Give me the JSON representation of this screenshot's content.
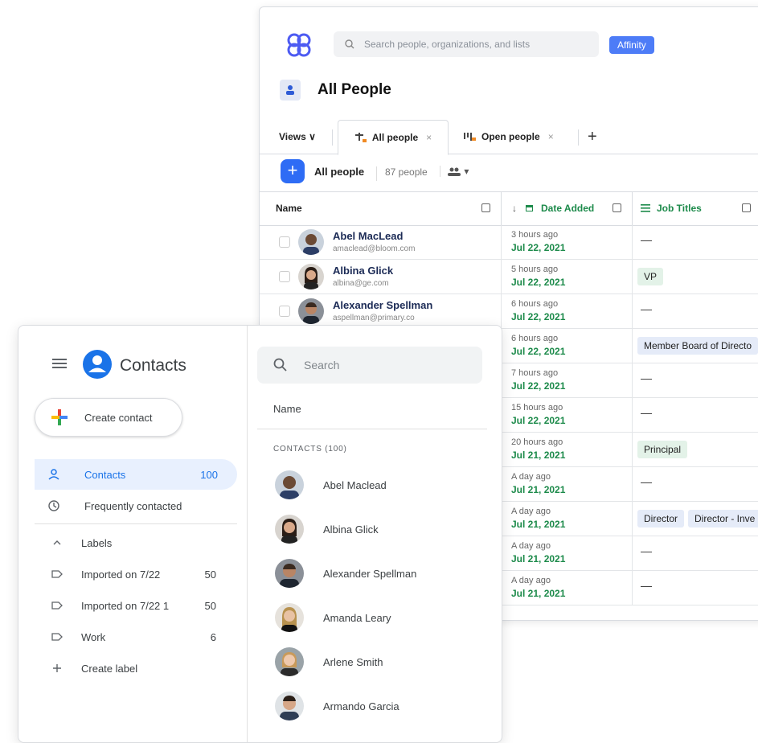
{
  "affinity": {
    "search_placeholder": "Search people, organizations, and lists",
    "badge": "Affinity",
    "title": "All People",
    "views_label": "Views ∨",
    "tabs": [
      {
        "label": "All people",
        "close": "×"
      },
      {
        "label": "Open people",
        "close": "×"
      }
    ],
    "add_tab": "+",
    "list_title": "All people",
    "people_count": "87 people",
    "people_dropdown": "▾",
    "columns": {
      "name": "Name",
      "date_added": "Date Added",
      "job_titles": "Job Titles",
      "date_sort": "↓"
    },
    "rows": [
      {
        "name": "Abel MacLead",
        "email": "amaclead@bloom.com",
        "rel": "3 hours ago",
        "date": "Jul 22, 2021",
        "job": "—"
      },
      {
        "name": "Albina Glick",
        "email": "albina@ge.com",
        "rel": "5 hours ago",
        "date": "Jul 22, 2021",
        "job": "VP"
      },
      {
        "name": "Alexander Spellman",
        "email": "aspellman@primary.co",
        "rel": "6 hours ago",
        "date": "Jul 22, 2021",
        "job": "—"
      },
      {
        "name": "",
        "email": "",
        "rel": "6 hours ago",
        "date": "Jul 22, 2021",
        "job": "Member Board of Directo"
      },
      {
        "name": "",
        "email": "",
        "rel": "7 hours ago",
        "date": "Jul 22, 2021",
        "job": "—"
      },
      {
        "name": "",
        "email": "",
        "rel": "15 hours ago",
        "date": "Jul 22, 2021",
        "job": "—"
      },
      {
        "name": "",
        "email": "",
        "rel": "20 hours ago",
        "date": "Jul 21, 2021",
        "job": "Principal"
      },
      {
        "name": "",
        "email": "",
        "rel": "A day ago",
        "date": "Jul 21, 2021",
        "job": "—"
      },
      {
        "name": "",
        "email": "",
        "rel": "A day ago",
        "date": "Jul 21, 2021",
        "job": "Director",
        "job2": "Director - Inve"
      },
      {
        "name": "",
        "email": "",
        "rel": "A day ago",
        "date": "Jul 21, 2021",
        "job": "—"
      },
      {
        "name": "",
        "email": "",
        "rel": "A day ago",
        "date": "Jul 21, 2021",
        "job": "—"
      }
    ]
  },
  "contacts": {
    "title": "Contacts",
    "create_label": "Create contact",
    "nav": [
      {
        "label": "Contacts",
        "count": "100"
      },
      {
        "label": "Frequently contacted",
        "count": ""
      }
    ],
    "labels_header": "Labels",
    "labels": [
      {
        "label": "Imported on 7/22",
        "count": "50"
      },
      {
        "label": "Imported on 7/22 1",
        "count": "50"
      },
      {
        "label": "Work",
        "count": "6"
      }
    ],
    "create_label_item": "Create label",
    "search_placeholder": "Search",
    "name_header": "Name",
    "section": "CONTACTS (100)",
    "list": [
      "Abel Maclead",
      "Albina Glick",
      "Alexander Spellman",
      "Amanda Leary",
      "Arlene Smith",
      "Armando Garcia"
    ]
  },
  "colors": {
    "affinity_blue": "#2e6cf5",
    "green": "#1c8a4a",
    "google_blue": "#1a73e8"
  }
}
